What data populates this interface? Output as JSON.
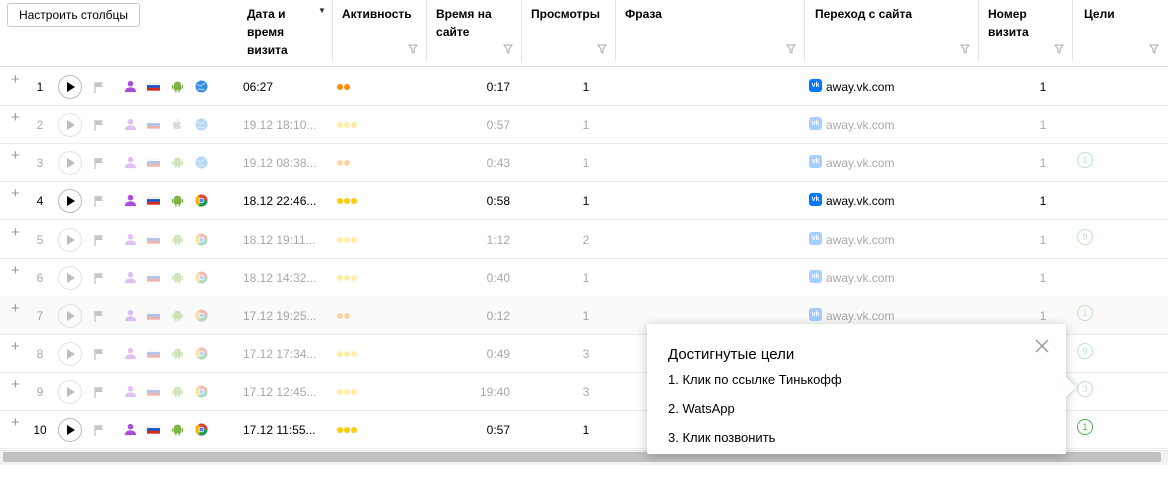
{
  "toolbar": {
    "configure_columns": "Настроить столбцы"
  },
  "columns": {
    "date": "Дата и\nвремя\nвизита",
    "activity": "Активность",
    "time_on_site": "Время на\nсайте",
    "views": "Просмотры",
    "phrase": "Фраза",
    "referrer": "Переход с сайта",
    "visit_number": "Номер\nвизита",
    "goals": "Цели"
  },
  "colors": {
    "orange_dot": "#ff8c00",
    "yellow_dot": "#ffcc00",
    "vk_blue": "#0077ff",
    "goal_green": "#4caf50"
  },
  "rows": [
    {
      "num": "1",
      "date": "06:27",
      "activity_dots": 2,
      "dot_color": "orange",
      "time": "0:17",
      "views": "1",
      "site": "away.vk.com",
      "visit": "1",
      "goal": "",
      "faded": false,
      "browser": "globe"
    },
    {
      "num": "2",
      "date": "19.12 18:10...",
      "activity_dots": 3,
      "dot_color": "yellow",
      "time": "0:57",
      "views": "1",
      "site": "away.vk.com",
      "visit": "1",
      "goal": "",
      "faded": true,
      "browser": "globe-light"
    },
    {
      "num": "3",
      "date": "19.12 08:38...",
      "activity_dots": 2,
      "dot_color": "orange",
      "time": "0:43",
      "views": "1",
      "site": "away.vk.com",
      "visit": "1",
      "goal": "1",
      "faded": true,
      "browser": "globe-light"
    },
    {
      "num": "4",
      "date": "18.12 22:46...",
      "activity_dots": 3,
      "dot_color": "yellow",
      "time": "0:58",
      "views": "1",
      "site": "away.vk.com",
      "visit": "1",
      "goal": "",
      "faded": false,
      "browser": "chrome"
    },
    {
      "num": "5",
      "date": "18.12 19:11...",
      "activity_dots": 3,
      "dot_color": "yellow",
      "time": "1:12",
      "views": "2",
      "site": "away.vk.com",
      "visit": "1",
      "goal": "9",
      "faded": true,
      "browser": "chrome"
    },
    {
      "num": "6",
      "date": "18.12 14:32...",
      "activity_dots": 3,
      "dot_color": "yellow",
      "time": "0:40",
      "views": "1",
      "site": "away.vk.com",
      "visit": "1",
      "goal": "",
      "faded": true,
      "browser": "chrome"
    },
    {
      "num": "7",
      "date": "17.12 19:25...",
      "activity_dots": 2,
      "dot_color": "orange",
      "time": "0:12",
      "views": "1",
      "site": "away.vk.com",
      "visit": "1",
      "goal": "1",
      "faded": true,
      "browser": "chrome"
    },
    {
      "num": "8",
      "date": "17.12 17:34...",
      "activity_dots": 3,
      "dot_color": "yellow",
      "time": "0:49",
      "views": "3",
      "site": "",
      "visit": "",
      "goal": "9",
      "faded": true,
      "browser": "chrome"
    },
    {
      "num": "9",
      "date": "17.12 12:45...",
      "activity_dots": 3,
      "dot_color": "yellow",
      "time": "19:40",
      "views": "3",
      "site": "",
      "visit": "",
      "goal": "3",
      "faded": true,
      "browser": "chrome"
    },
    {
      "num": "10",
      "date": "17.12 11:55...",
      "activity_dots": 3,
      "dot_color": "yellow",
      "time": "0:57",
      "views": "1",
      "site": "",
      "visit": "",
      "goal": "1",
      "faded": false,
      "browser": "chrome"
    }
  ],
  "popup": {
    "title": "Достигнутые цели",
    "items": [
      "1. Клик по ссылке Тинькофф",
      "2. WatsApp",
      "3. Клик позвонить"
    ]
  }
}
